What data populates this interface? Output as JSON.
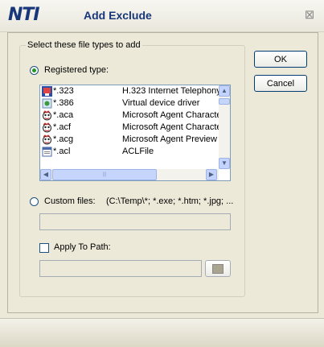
{
  "window": {
    "logo": "NTI",
    "title": "Add Exclude",
    "close_glyph": "⊠"
  },
  "group": {
    "label": "Select these file types to add"
  },
  "buttons": {
    "ok": "OK",
    "cancel": "Cancel"
  },
  "registered": {
    "label": "Registered type:",
    "selected": true,
    "rows": [
      {
        "icon": "netmeeting-icon",
        "ext": "*.323",
        "desc": "H.323 Internet Telephony"
      },
      {
        "icon": "virtual-device-icon",
        "ext": "*.386",
        "desc": "Virtual device driver"
      },
      {
        "icon": "agent-character-icon",
        "ext": "*.aca",
        "desc": "Microsoft Agent Character"
      },
      {
        "icon": "agent-character-icon",
        "ext": "*.acf",
        "desc": "Microsoft Agent Character"
      },
      {
        "icon": "agent-character-icon",
        "ext": "*.acg",
        "desc": "Microsoft Agent Preview"
      },
      {
        "icon": "aclfile-icon",
        "ext": "*.acl",
        "desc": "ACLFile"
      }
    ]
  },
  "custom": {
    "label": "Custom files:",
    "hint": "(C:\\Temp\\*; *.exe; *.htm; *.jpg; ...",
    "selected": false,
    "value": ""
  },
  "apply_path": {
    "label": "Apply To Path:",
    "checked": false,
    "value": ""
  },
  "colors": {
    "title": "#17377a",
    "window_bg": "#ece9d8",
    "radio_dot": "#219721"
  }
}
